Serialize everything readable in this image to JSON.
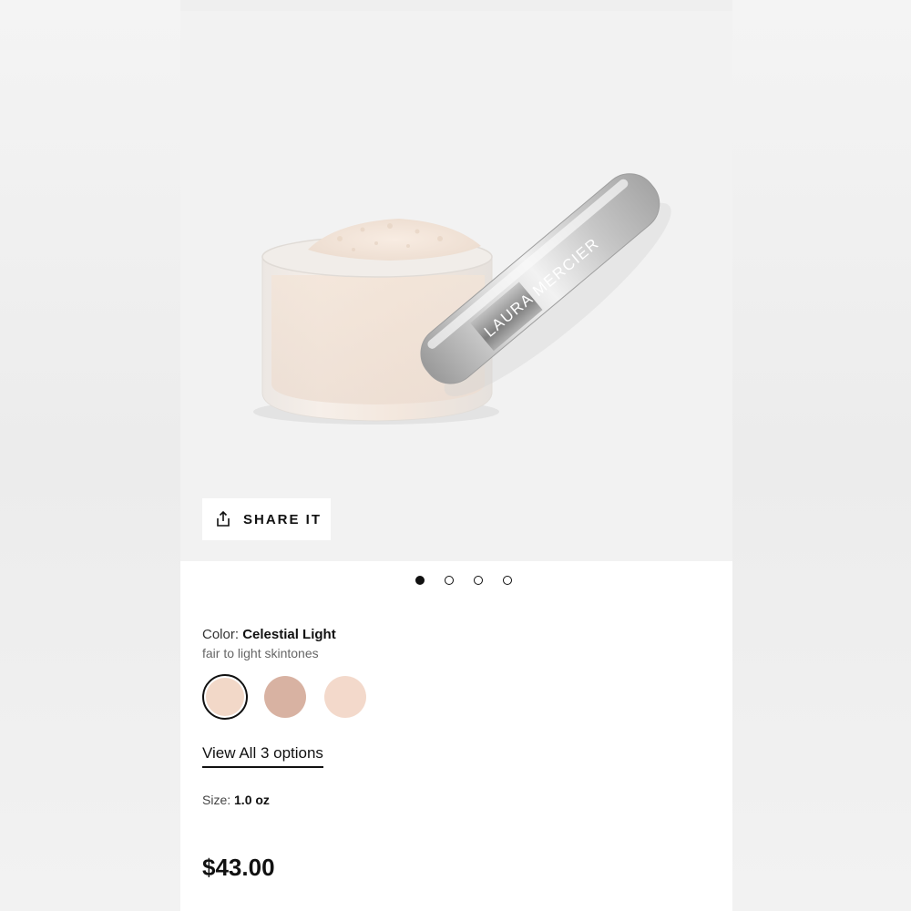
{
  "product": {
    "brand_on_lid": "LAURA MERCIER",
    "share_label": "SHARE IT",
    "carousel": {
      "total": 4,
      "active_index": 0
    },
    "color_label": "Color:",
    "color_value": "Celestial Light",
    "color_description": "fair to light skintones",
    "swatches": [
      {
        "name": "Celestial Light",
        "color": "#f2d8c8",
        "selected": true
      },
      {
        "name": "swatch-2",
        "color": "#d8b2a2",
        "selected": false
      },
      {
        "name": "swatch-3",
        "color": "#f3d9cb",
        "selected": false
      }
    ],
    "view_all_label": "View All 3 options",
    "size_label": "Size:",
    "size_value": "1.0 oz",
    "price": "$43.00"
  },
  "icons": {
    "share": "share-icon"
  }
}
